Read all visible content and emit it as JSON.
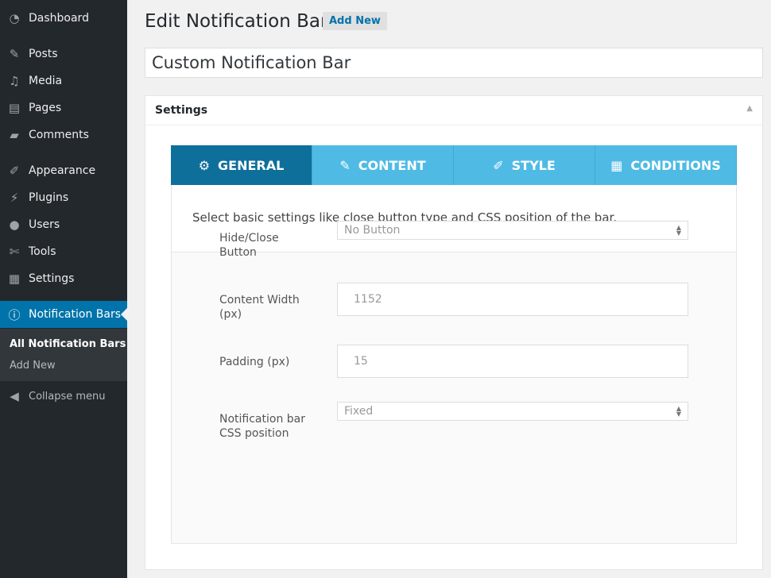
{
  "sidebar": {
    "items": [
      {
        "label": "Dashboard",
        "icon": "dashboard-icon",
        "glyph": "◔"
      },
      {
        "label": "Posts",
        "icon": "pin-icon",
        "glyph": "✎"
      },
      {
        "label": "Media",
        "icon": "media-icon",
        "glyph": "♫"
      },
      {
        "label": "Pages",
        "icon": "pages-icon",
        "glyph": "▤"
      },
      {
        "label": "Comments",
        "icon": "comment-icon",
        "glyph": "▰"
      },
      {
        "label": "Appearance",
        "icon": "brush-icon",
        "glyph": "✐"
      },
      {
        "label": "Plugins",
        "icon": "plug-icon",
        "glyph": "⚡"
      },
      {
        "label": "Users",
        "icon": "user-icon",
        "glyph": "●"
      },
      {
        "label": "Tools",
        "icon": "wrench-icon",
        "glyph": "✄"
      },
      {
        "label": "Settings",
        "icon": "settings-icon",
        "glyph": "▦"
      },
      {
        "label": "Notification Bars",
        "icon": "info-icon",
        "glyph": "ⓘ"
      }
    ],
    "submenu": [
      "All Notification Bars",
      "Add New"
    ],
    "collapse": "Collapse menu"
  },
  "header": {
    "title": "Edit Notification Bar",
    "add_new": "Add New"
  },
  "post_title": "Custom Notification Bar",
  "settings": {
    "title": "Settings",
    "tabs": [
      {
        "label": "GENERAL",
        "icon": "gear-icon",
        "glyph": "⚙"
      },
      {
        "label": "CONTENT",
        "icon": "pencil-icon",
        "glyph": "✎"
      },
      {
        "label": "STYLE",
        "icon": "brush-icon",
        "glyph": "✐"
      },
      {
        "label": "CONDITIONS",
        "icon": "settings-icon",
        "glyph": "▦"
      }
    ],
    "description": "Select basic settings like close button type and CSS position of the bar.",
    "fields": [
      {
        "label": "Hide/Close Button",
        "value": "No Button",
        "type": "select"
      },
      {
        "label": "Content Width (px)",
        "value": "1152",
        "type": "input"
      },
      {
        "label": "Padding (px)",
        "value": "15",
        "type": "input"
      },
      {
        "label": "Notification bar CSS position",
        "value": "Fixed",
        "type": "select"
      }
    ]
  },
  "colors": {
    "sidebar": "#23282d",
    "active": "#0073aa",
    "tab": "#4fbbe5",
    "tab_active": "#0f6f9b"
  }
}
